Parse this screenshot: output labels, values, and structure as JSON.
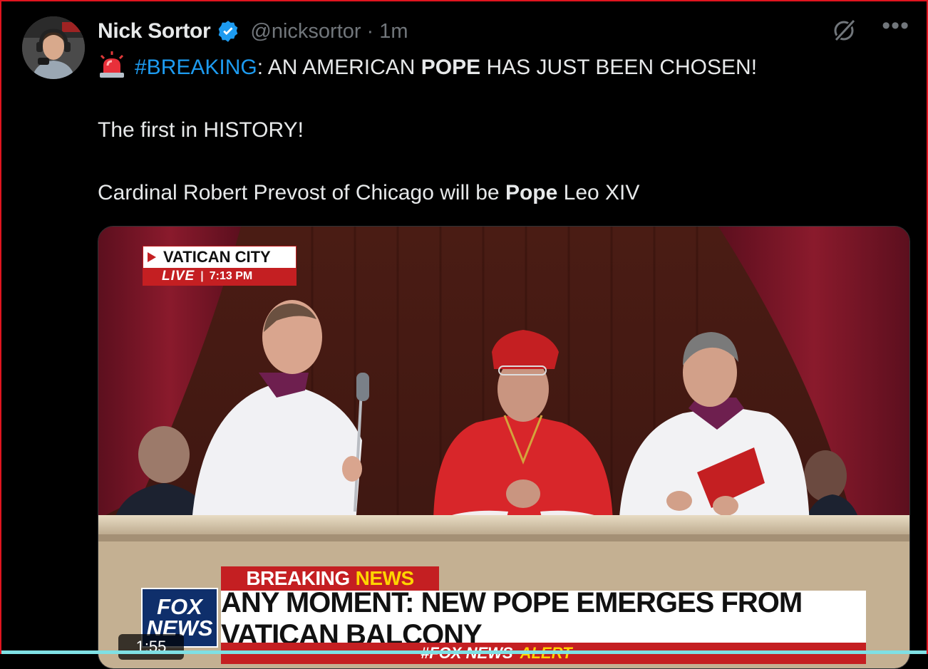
{
  "author": {
    "name": "Nick Sortor",
    "handle": "@nicksortor",
    "separator": "·",
    "time": "1m",
    "verified_icon": "verified-badge-icon",
    "verified_color": "#1d9bf0"
  },
  "header_icons": {
    "grok": "grok-icon",
    "more": "•••"
  },
  "tweet": {
    "siren_icon": "police-siren-emoji-icon",
    "hashtag": "#BREAKING",
    "line1_a": ": AN AMERICAN ",
    "line1_b": "POPE",
    "line1_c": " HAS JUST BEEN CHOSEN!",
    "line2": "The first in HISTORY!",
    "line3_a": "Cardinal Robert Prevost of Chicago will be ",
    "line3_b": "Pope",
    "line3_c": " Leo XIV"
  },
  "video": {
    "location": "VATICAN CITY",
    "live": "LIVE",
    "time": "7:13 PM",
    "breaking": "BREAKING",
    "news": "NEWS",
    "headline": "ANY MOMENT: NEW POPE EMERGES FROM VATICAN BALCONY",
    "ticker_a": "#FOX NEWS",
    "ticker_b": "ALERT",
    "logo_line1": "FOX",
    "logo_line2": "NEWS",
    "duration": "1:55"
  },
  "colors": {
    "background": "#000000",
    "text": "#e7e9ea",
    "muted": "#71767b",
    "accent": "#1d9bf0",
    "fox_red": "#c41f22",
    "fox_yellow": "#ffd400"
  }
}
